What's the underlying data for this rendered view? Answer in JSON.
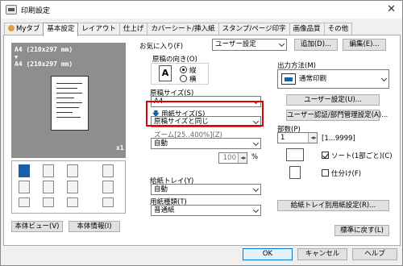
{
  "window": {
    "title": "印刷設定",
    "close_glyph": "✕"
  },
  "tabs": [
    "Myタブ",
    "基本設定",
    "レイアウト",
    "仕上げ",
    "カバーシート/挿入紙",
    "スタンプ/ページ印字",
    "画像品質",
    "その他"
  ],
  "favorites": {
    "label": "お気に入り(F)",
    "value": "ユーザー設定",
    "add": "追加(D)...",
    "edit": "編集(E)..."
  },
  "preview": {
    "line1": "A4 (210x297 mm)",
    "line2": "A4 (210x297 mm)",
    "zoom": "x1"
  },
  "left_buttons": {
    "machine_view": "本体ビュー(V)",
    "machine_info": "本体情報(I)"
  },
  "orientation": {
    "label": "原稿の向き(O)",
    "portrait": "縦",
    "landscape": "横",
    "selected": "portrait"
  },
  "original_size": {
    "label": "原稿サイズ(S)",
    "value": "A4"
  },
  "paper_size": {
    "label": "用紙サイズ(S)",
    "value": "原稿サイズと同じ"
  },
  "zoom": {
    "label": "ズーム[25..400%](Z)",
    "value": "自動",
    "percent_value": "100",
    "percent_unit": "%"
  },
  "paper_tray": {
    "label": "給紙トレイ(Y)",
    "value": "自動"
  },
  "paper_type": {
    "label": "用紙種類(T)",
    "value": "普通紙"
  },
  "output_method": {
    "label": "出力方法(M)",
    "value": "通常印刷",
    "user_settings": "ユーザー設定(U)...",
    "auth": "ユーザー認証/部門管理設定(A)..."
  },
  "copies": {
    "label": "部数(P)",
    "value": "1",
    "range": "[1...9999]"
  },
  "collate": {
    "label": "ソート(1部ごと)(C)",
    "checked": true
  },
  "offset": {
    "label": "仕分け(F)",
    "checked": false
  },
  "tray_settings": "給紙トレイ別用紙設定(R)...",
  "restore_defaults": "標準に戻す(L)",
  "footer": {
    "ok": "OK",
    "cancel": "キャンセル",
    "help": "ヘルプ"
  },
  "colors": {
    "highlight": "#e00000",
    "accent": "#1b5fa8"
  }
}
